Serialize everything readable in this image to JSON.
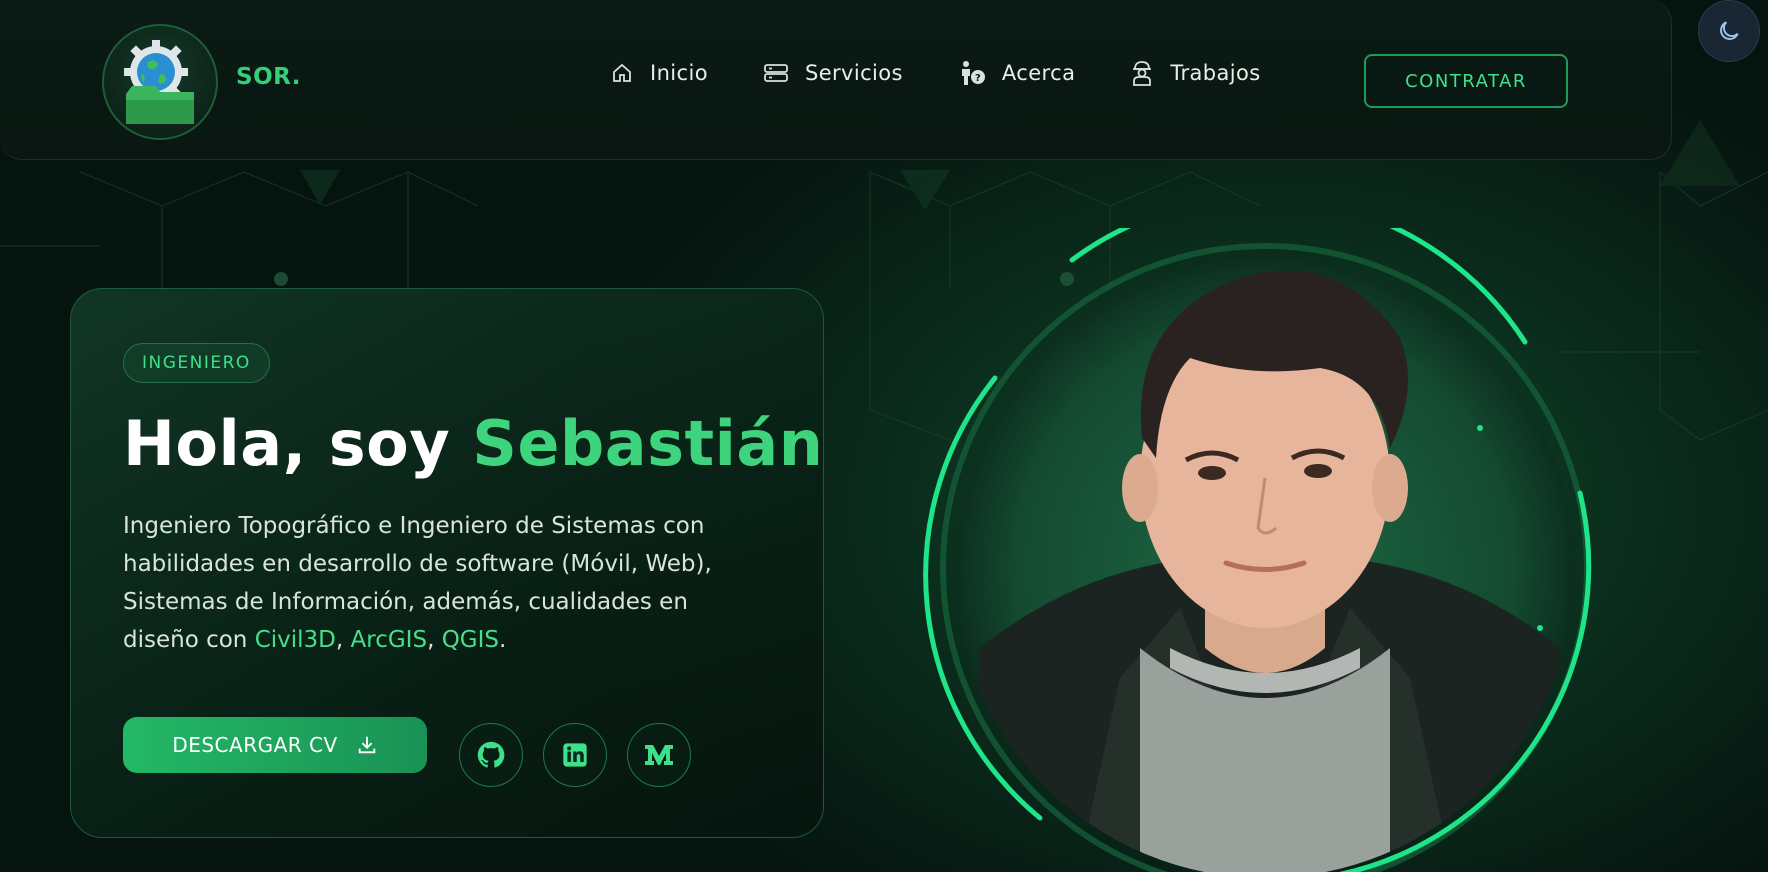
{
  "header": {
    "brand": "SOR.",
    "nav": [
      {
        "label": "Inicio",
        "icon": "home-icon"
      },
      {
        "label": "Servicios",
        "icon": "server-icon"
      },
      {
        "label": "Acerca",
        "icon": "person-question-icon"
      },
      {
        "label": "Trabajos",
        "icon": "worker-icon"
      }
    ],
    "hire_label": "CONTRATAR",
    "theme_icon": "moon-icon"
  },
  "hero": {
    "badge": "INGENIERO",
    "greeting": "Hola, soy ",
    "name": "Sebastián",
    "desc_part1": "Ingeniero Topográfico e Ingeniero de Sistemas con habilidades en desarrollo de software (Móvil, Web), Sistemas de Información, además, cualidades en diseño con ",
    "tool1": "Civil3D",
    "sep1": ", ",
    "tool2": "ArcGIS",
    "sep2": ", ",
    "tool3": "QGIS",
    "desc_end": ".",
    "cv_label": "DESCARGAR CV",
    "socials": [
      "github-icon",
      "linkedin-icon",
      "medium-icon"
    ]
  },
  "colors": {
    "accent": "#3ed47e",
    "background": "#07150f",
    "ring": "#1ee58a"
  }
}
